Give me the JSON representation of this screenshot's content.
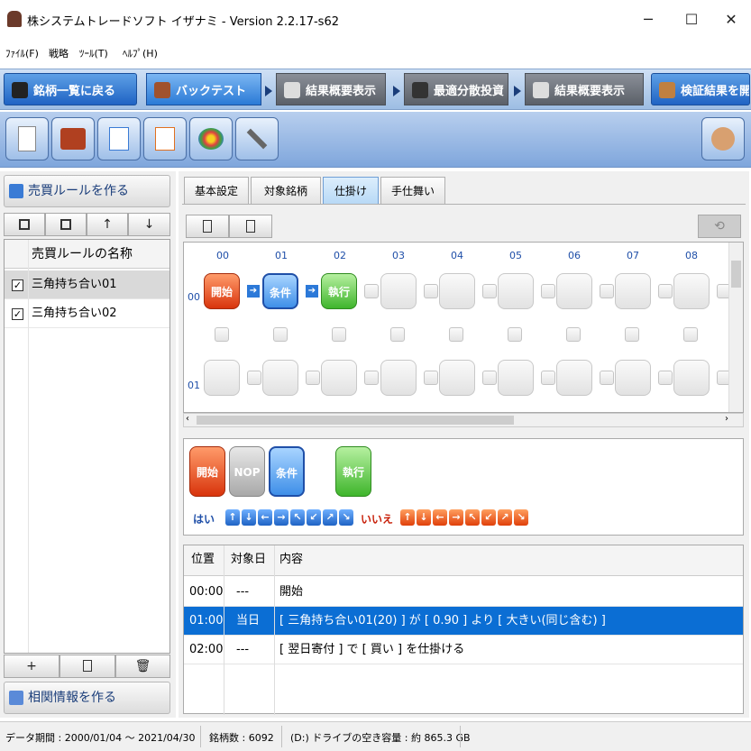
{
  "window": {
    "title": "株システムトレードソフト イザナミ - Version 2.2.17-s62",
    "minimize": "─",
    "maximize": "☐",
    "close": "✕"
  },
  "menu": [
    "ﾌｧｲﾙ(F)",
    "戦略",
    "ﾂｰﾙ(T)",
    "ﾍﾙﾌﾟ(H)"
  ],
  "nav": {
    "back": "銘柄一覧に戻る",
    "backtest": "バックテスト",
    "summary1": "結果概要表示",
    "optimize": "最適分散投資",
    "summary2": "結果概要表示",
    "verify": "検証結果を開く"
  },
  "left": {
    "header": "売買ルールを作る",
    "list_header": "売買ルールの名称",
    "rules": [
      {
        "name": "三角持ち合い01",
        "checked": "✓"
      },
      {
        "name": "三角持ち合い02",
        "checked": "✓"
      }
    ],
    "footer": "相関情報を作る",
    "btn_up": "↑",
    "btn_down": "↓",
    "btn_add": "+",
    "btn_delete": "🗑"
  },
  "subtabs": [
    "基本設定",
    "対象銘柄",
    "仕掛け",
    "手仕舞い"
  ],
  "canvas": {
    "cols": [
      "00",
      "01",
      "02",
      "03",
      "04",
      "05",
      "06",
      "07",
      "08"
    ],
    "rows": [
      "00",
      "01"
    ],
    "nodes": {
      "start": "開始",
      "cond": "条件",
      "exec": "執行"
    }
  },
  "palette": {
    "start": "開始",
    "nop": "NOP",
    "cond": "条件",
    "exec": "執行",
    "yes": "はい",
    "no": "いいえ"
  },
  "steps": {
    "headers": [
      "位置",
      "対象日",
      "内容"
    ],
    "rows": [
      {
        "pos": "00:00",
        "day": "---",
        "content": "開始"
      },
      {
        "pos": "01:00",
        "day": "当日",
        "content": "[ 三角持ち合い01(20) ] が [ 0.90 ] より [ 大きい(同じ含む) ]"
      },
      {
        "pos": "02:00",
        "day": "---",
        "content": "[ 翌日寄付 ] で [ 買い ] を仕掛ける"
      }
    ]
  },
  "status": {
    "period": "データ期間 : 2000/01/04 〜 2021/04/30",
    "count": "銘柄数 : 6092",
    "disk": "(D:) ドライブの空き容量 : 約 865.3 GB"
  },
  "colors": {
    "accent": "#0b6ed4",
    "start_node": "#d8340c",
    "cond_node": "#3f8fe8",
    "exec_node": "#3fb52c"
  }
}
